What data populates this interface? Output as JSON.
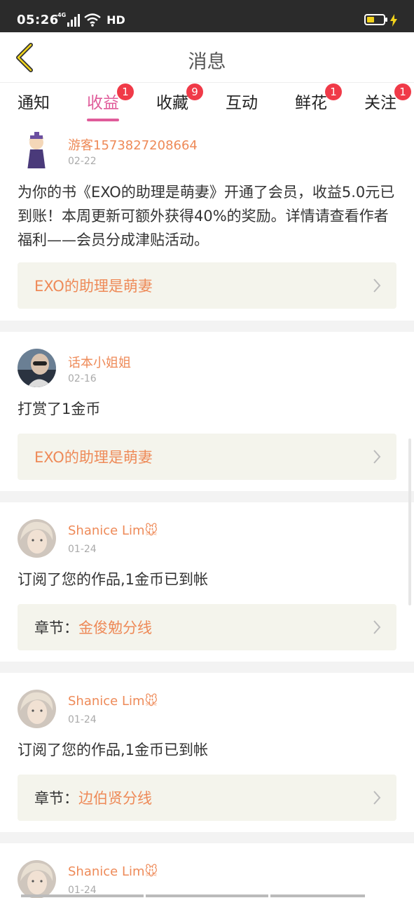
{
  "status_bar": {
    "time": "05:26",
    "network": "4G",
    "hd": "HD",
    "icons": [
      "signal-icon",
      "wifi-icon",
      "battery-icon",
      "charging-bolt-icon"
    ]
  },
  "header": {
    "title": "消息",
    "back_icon": "chevron-left-icon"
  },
  "tabs": [
    {
      "label": "通知",
      "badge": "",
      "active": false
    },
    {
      "label": "收益",
      "badge": "1",
      "active": true
    },
    {
      "label": "收藏",
      "badge": "9",
      "active": false
    },
    {
      "label": "互动",
      "badge": "",
      "active": false
    },
    {
      "label": "鲜花",
      "badge": "1",
      "active": false
    },
    {
      "label": "关注",
      "badge": "1",
      "active": false
    }
  ],
  "messages": [
    {
      "user": "游客1573827208664",
      "date": "02-22",
      "text": "为你的书《EXO的助理是萌妻》开通了会员，收益5.0元已到账！本周更新可额外获得40%的奖励。详情请查看作者福利——会员分成津贴活动。",
      "link_prefix": "",
      "link": "EXO的助理是萌妻"
    },
    {
      "user": "话本小姐姐",
      "date": "02-16",
      "text": "打赏了1金币",
      "link_prefix": "",
      "link": "EXO的助理是萌妻"
    },
    {
      "user": "Shanice Lim🐭",
      "date": "01-24",
      "text": "订阅了您的作品,1金币已到帐",
      "link_prefix": "章节：",
      "link": "金俊勉分线"
    },
    {
      "user": "Shanice Lim🐭",
      "date": "01-24",
      "text": "订阅了您的作品,1金币已到帐",
      "link_prefix": "章节：",
      "link": "边伯贤分线"
    },
    {
      "user": "Shanice Lim🐭",
      "date": "01-24",
      "text": "",
      "link_prefix": "",
      "link": ""
    }
  ],
  "colors": {
    "accent_pink": "#e05b9a",
    "name_orange": "#ee8a58",
    "badge_red": "#f03a48",
    "link_box_bg": "#f4f4ec"
  }
}
